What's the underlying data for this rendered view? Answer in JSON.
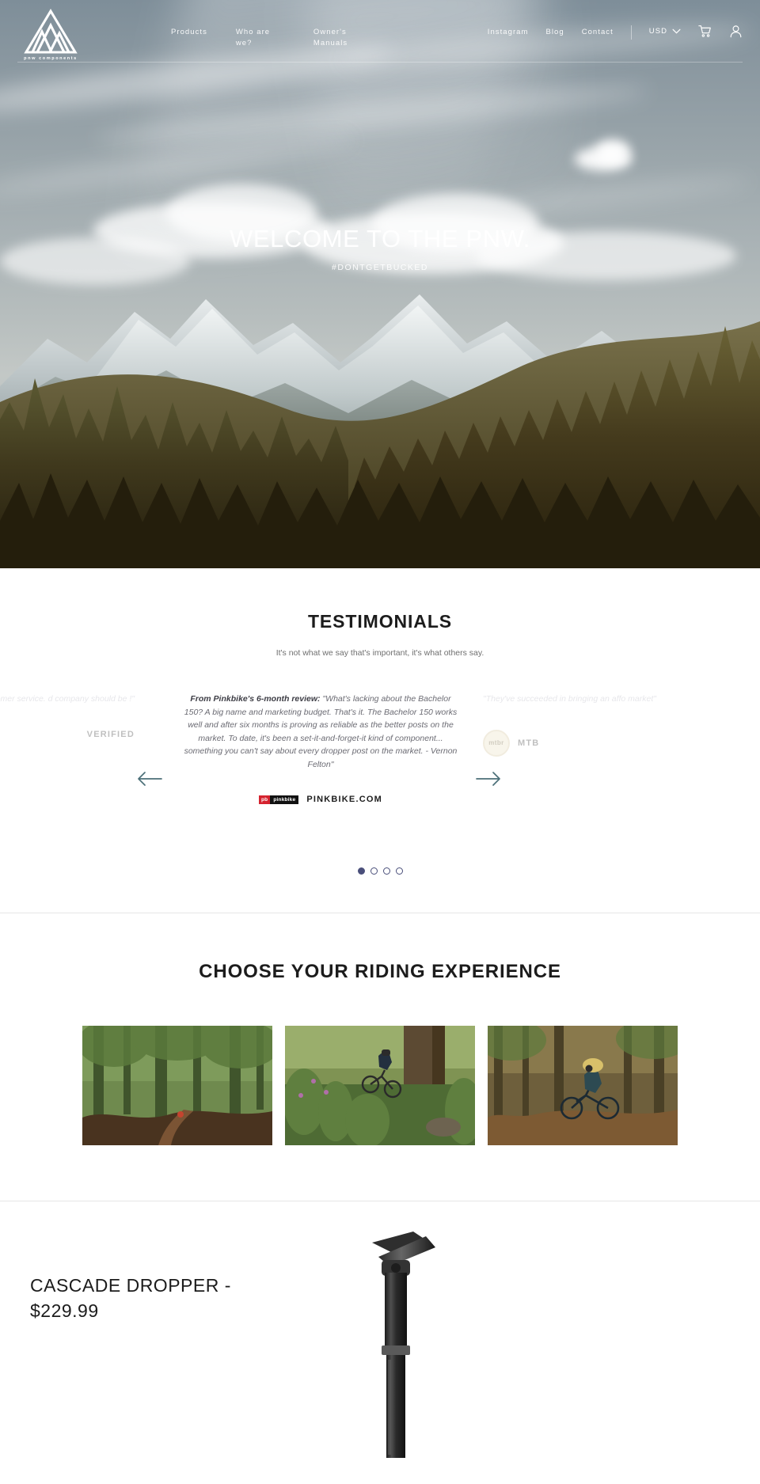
{
  "site": {
    "brand_word": "pnw components",
    "logo_icon": "mountain-logo-icon"
  },
  "nav": {
    "center_links": [
      {
        "label": "Products"
      },
      {
        "label": "Who are we?"
      },
      {
        "label": "Owner's Manuals"
      }
    ],
    "right_links": [
      {
        "label": "Instagram"
      },
      {
        "label": "Blog"
      },
      {
        "label": "Contact"
      }
    ],
    "currency": {
      "value": "USD",
      "chevron_icon": "chevron-down-icon"
    },
    "cart_icon": "shopping-cart-icon",
    "account_icon": "user-account-icon"
  },
  "hero": {
    "title": "WELCOME TO THE PNW.",
    "subtitle": "#DONTGETBUCKED"
  },
  "testimonials": {
    "heading": "TESTIMONIALS",
    "subheading": "It's not what we say that's important, it's what others say.",
    "prev_arrow_icon": "arrow-left-icon",
    "next_arrow_icon": "arrow-right-icon",
    "slides": [
      {
        "position": "prev",
        "lead": "",
        "quote": "d quality. Superb customer service. d company should be !\"",
        "source_name": "VERIFIED",
        "badge_text": ""
      },
      {
        "position": "active",
        "lead": "From Pinkbike's 6-month review:",
        "quote": " \"What's lacking about the Bachelor 150? A big name and marketing budget. That's it. The Bachelor 150 works well and after six months is proving as reliable as the better posts on the market. To date, it's been a set-it-and-forget-it kind of component... something you can't say about every dropper post on the market. - Vernon Felton\"",
        "source_name": "PINKBIKE.COM",
        "logo_red": "pb",
        "logo_black": "pinkbike"
      },
      {
        "position": "next",
        "lead": "",
        "quote": "\"They've succeeded in bringing an affo market\"",
        "source_name": "MTB",
        "badge_text": "mtbr"
      }
    ],
    "dots": [
      {
        "active": true
      },
      {
        "active": false
      },
      {
        "active": false
      },
      {
        "active": false
      }
    ]
  },
  "riding": {
    "heading": "CHOOSE YOUR RIDING EXPERIENCE",
    "cards": [
      {
        "name": "forest-trail-card"
      },
      {
        "name": "rider-descending-card"
      },
      {
        "name": "rider-in-woods-card"
      }
    ]
  },
  "product": {
    "title": "CASCADE DROPPER - $229.99",
    "image_name": "dropper-seatpost-image"
  },
  "colors": {
    "accent": "#4a4f7a",
    "arrow": "#4b6f78",
    "pinkbike_red": "#d5232f",
    "text_dark": "#1c1c1c",
    "text_muted": "#6f6f6f"
  }
}
